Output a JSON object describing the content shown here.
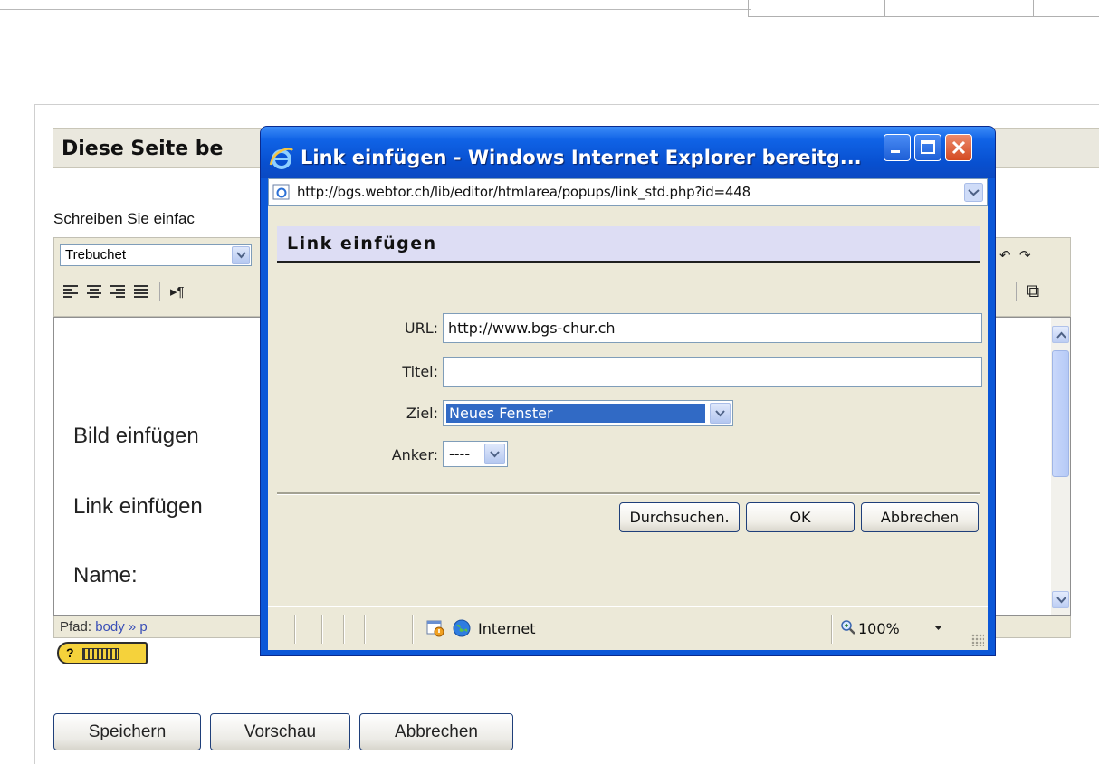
{
  "page": {
    "heading": "Diese Seite be",
    "instruction": "Schreiben Sie einfac",
    "font_select_value": "Trebuchet",
    "editor_lines": [
      "Bild einfügen",
      "Link einfügen",
      "Name:"
    ],
    "path_label": "Pfad:",
    "path_body": "body",
    "path_sep": "»",
    "path_p": "p",
    "help_badge": "?",
    "buttons": {
      "save": "Speichern",
      "preview": "Vorschau",
      "cancel": "Abbrechen"
    }
  },
  "popup": {
    "window_title": "Link einfügen - Windows Internet Explorer bereitg...",
    "address": "http://bgs.webtor.ch/lib/editor/htmlarea/popups/link_std.php?id=448",
    "dialog_title": "Link einfügen",
    "fields": {
      "url_label": "URL:",
      "url_value": "http://www.bgs-chur.ch",
      "title_label": "Titel:",
      "title_value": "",
      "target_label": "Ziel:",
      "target_value": "Neues Fenster",
      "anchor_label": "Anker:",
      "anchor_value": "----"
    },
    "buttons": {
      "browse": "Durchsuchen.",
      "ok": "OK",
      "cancel": "Abbrechen"
    },
    "status": {
      "zone": "Internet",
      "zoom": "100%"
    }
  },
  "colors": {
    "title_bar": "#0b57d8",
    "selection": "#316ac5",
    "dialog_header_bg": "#ddddf4",
    "window_face": "#ece9d8"
  },
  "icons": {
    "ie_logo": "ie-logo-icon",
    "page": "ie-page-icon",
    "minimize": "minimize-icon",
    "maximize": "maximize-icon",
    "close": "close-icon",
    "globe": "globe-icon",
    "zoom": "magnifier-icon"
  }
}
